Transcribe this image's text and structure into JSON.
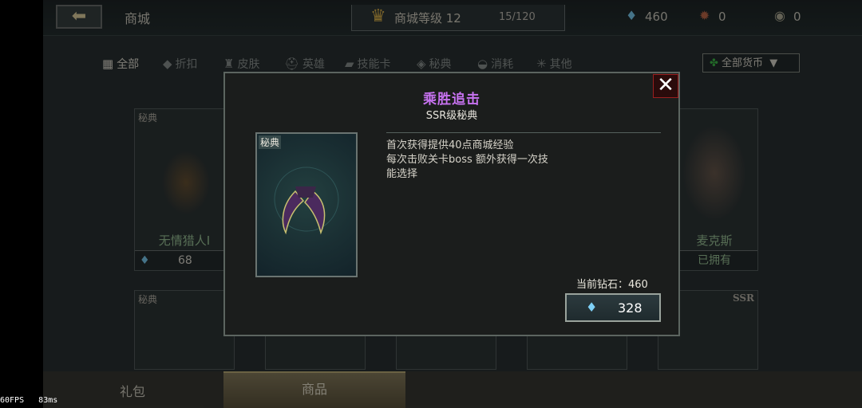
{
  "topbar": {
    "back_icon": "back-arrow-icon",
    "title": "商城",
    "level_label": "商城等级 12",
    "level_progress": "15/120",
    "diamonds": "460",
    "currency2": "0",
    "currency3": "0"
  },
  "filters": [
    "全部",
    "折扣",
    "皮肤",
    "英雄",
    "技能卡",
    "秘典",
    "消耗",
    "其他"
  ],
  "currency_dropdown": "全部货币",
  "cards": {
    "left_tag": "秘典",
    "left_name": "无情猎人Ⅰ",
    "left_price": "68",
    "right_name": "麦克斯",
    "right_status": "已拥有",
    "row2_left_tag": "秘典",
    "row2_right_tag": "SSR"
  },
  "modal": {
    "title": "乘胜追击",
    "subtitle": "SSR级秘典",
    "item_tag": "秘典",
    "desc_line1": "首次获得提供40点商城经验",
    "desc_line2": "每次击败关卡boss 额外获得一次技",
    "desc_line3": "能选择",
    "balance": "当前钻石：460",
    "price": "328"
  },
  "bottom_tabs": {
    "gift": "礼包",
    "goods": "商品"
  },
  "overlay": {
    "fps": "60FPS",
    "ms": "83ms"
  },
  "colors": {
    "title_purple": "#c772f0",
    "diamond_blue": "#7fd1f7",
    "name_green": "#9fc99c",
    "close_red": "#9a1f1f"
  }
}
